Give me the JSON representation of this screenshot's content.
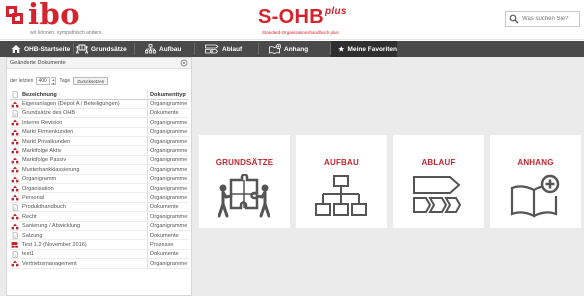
{
  "app": {
    "logo_text": "ibo",
    "logo_tagline": "wir können. sympathisch anders.",
    "product_name": "S-OHB",
    "product_suffix": "plus",
    "product_subtitle": "Standard-Organisationshandbuch plus",
    "brand_color": "#d4232c"
  },
  "search": {
    "placeholder": "Was suchen Sie?",
    "value": ""
  },
  "nav": {
    "items": [
      {
        "label": "OHB-Startseite",
        "icon": "home-icon"
      },
      {
        "label": "Grundsätze",
        "icon": "puzzle-people-icon"
      },
      {
        "label": "Aufbau",
        "icon": "org-chart-icon"
      },
      {
        "label": "Ablauf",
        "icon": "process-flow-icon"
      },
      {
        "label": "Anhang",
        "icon": "book-plus-icon"
      },
      {
        "label": "Meine Favoriten",
        "icon": "star-icon"
      }
    ]
  },
  "panel": {
    "title": "Geänderte Dokumente",
    "filter_prefix": "der letzten",
    "days_value": "400",
    "filter_suffix": "Tage",
    "reset_label": "Zurücksetzen",
    "columns": {
      "name": "Bezeichnung",
      "sort_mark": "↑",
      "type": "Dokumenttyp"
    },
    "rows": [
      {
        "name": "Eigenanlagen (Depot A / Beteiligungen)",
        "type": "Organigramme",
        "icon": "org-icon"
      },
      {
        "name": "Grundsätze des OHB",
        "type": "Dokumente",
        "icon": "doc-icon"
      },
      {
        "name": "Interne Revision",
        "type": "Organigramme",
        "icon": "org-icon"
      },
      {
        "name": "Markt Firmenkunden",
        "type": "Organigramme",
        "icon": "org-icon"
      },
      {
        "name": "Markt Privatkunden",
        "type": "Organigramme",
        "icon": "org-icon"
      },
      {
        "name": "Marktfolge Aktiv",
        "type": "Organigramme",
        "icon": "org-icon"
      },
      {
        "name": "Marktfolge Passiv",
        "type": "Organigramme",
        "icon": "org-icon"
      },
      {
        "name": "Musterbankklassierung",
        "type": "Organigramme",
        "icon": "org-icon"
      },
      {
        "name": "Organigramm",
        "type": "Organigramme",
        "icon": "org-icon"
      },
      {
        "name": "Organisation",
        "type": "Organigramme",
        "icon": "org-icon"
      },
      {
        "name": "Personal",
        "type": "Organigramme",
        "icon": "org-icon"
      },
      {
        "name": "Produkthandbuch",
        "type": "Dokumente",
        "icon": "doc-icon"
      },
      {
        "name": "Recht",
        "type": "Organigramme",
        "icon": "org-icon"
      },
      {
        "name": "Sanierung / Abwicklung",
        "type": "Organigramme",
        "icon": "org-icon"
      },
      {
        "name": "Satzung",
        "type": "Dokumente",
        "icon": "doc-icon"
      },
      {
        "name": "Test 1.2 (November 2016)",
        "type": "Prozesse",
        "icon": "process-icon"
      },
      {
        "name": "test1",
        "type": "Dokumente",
        "icon": "doc-icon"
      },
      {
        "name": "Vertriebsmanagement",
        "type": "Organigramme",
        "icon": "org-icon"
      }
    ]
  },
  "tiles": [
    {
      "label": "GRUNDSÄTZE",
      "icon": "puzzle-people-icon"
    },
    {
      "label": "AUFBAU",
      "icon": "org-chart-icon"
    },
    {
      "label": "ABLAUF",
      "icon": "process-flow-icon"
    },
    {
      "label": "ANHANG",
      "icon": "book-plus-icon"
    }
  ]
}
